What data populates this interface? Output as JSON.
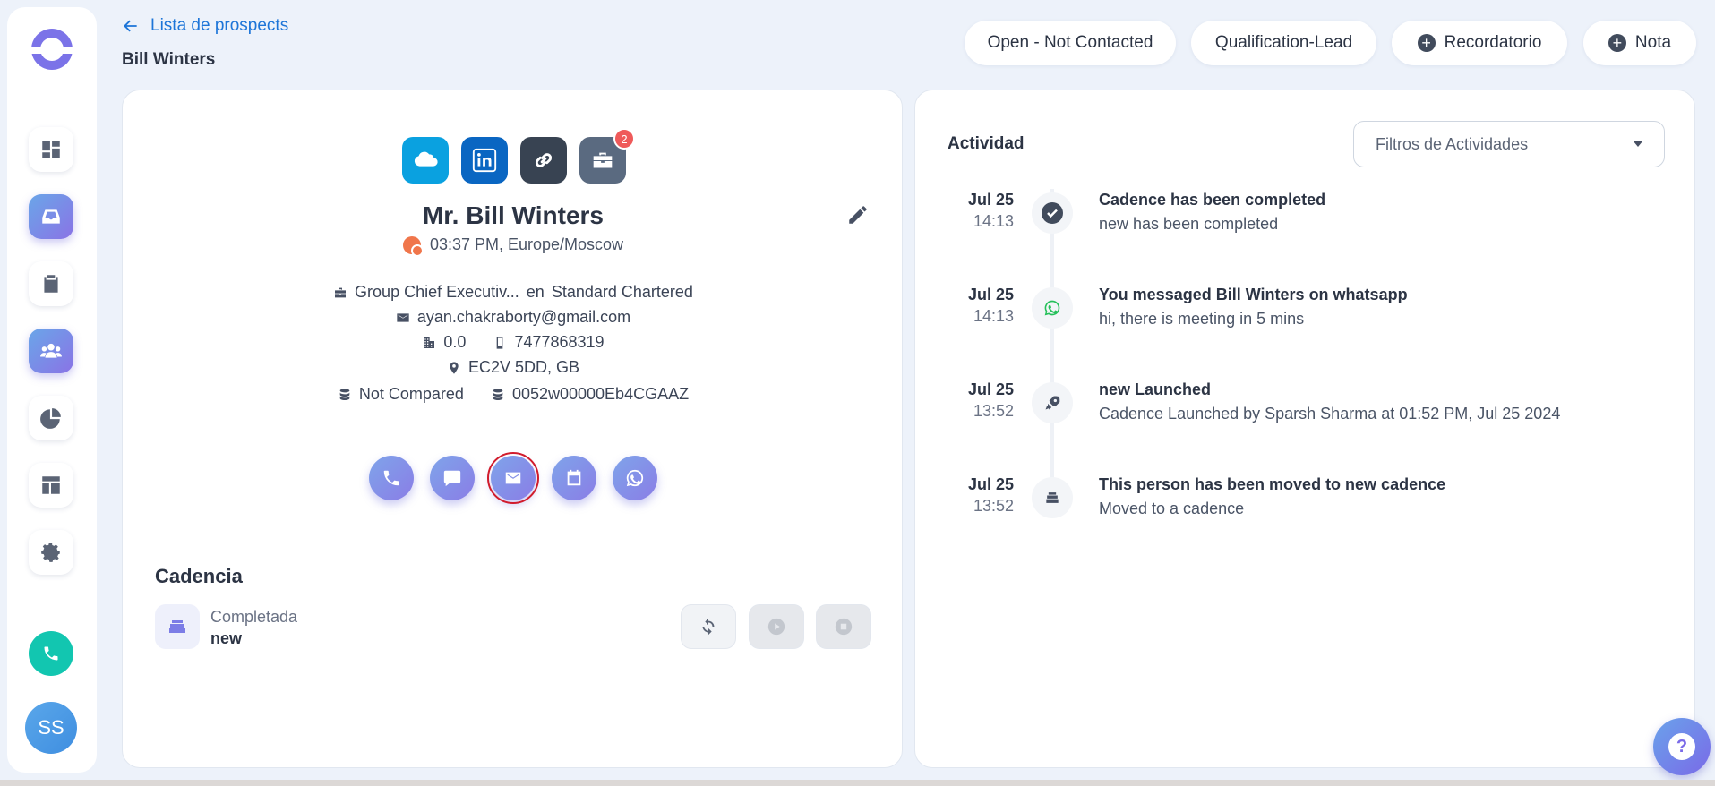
{
  "header": {
    "back_label": "Lista de prospects",
    "page_title": "Bill Winters",
    "status_pills": [
      "Open - Not Contacted",
      "Qualification-Lead"
    ],
    "reminder_label": "Recordatorio",
    "note_label": "Nota"
  },
  "sidebar": {
    "items": [
      "dashboard",
      "inbox",
      "tasks",
      "prospects",
      "reports",
      "templates",
      "settings"
    ],
    "active": "prospects",
    "avatar_initials": "SS"
  },
  "profile": {
    "social_badge": "2",
    "name": "Mr. Bill Winters",
    "timezone": "03:37 PM, Europe/Moscow",
    "title": "Group Chief Executiv...",
    "company_prefix": "en",
    "company": "Standard Chartered",
    "email": "ayan.chakraborty@gmail.com",
    "score": "0.0",
    "phone": "7477868319",
    "location": "EC2V 5DD, GB",
    "compare_status": "Not Compared",
    "record_id": "0052w00000Eb4CGAAZ"
  },
  "cadence": {
    "section_title": "Cadencia",
    "status": "Completada",
    "name": "new"
  },
  "activity": {
    "title": "Actividad",
    "filter_placeholder": "Filtros de Actividades",
    "items": [
      {
        "date": "Jul 25",
        "time": "14:13",
        "icon": "check-icon",
        "title": "Cadence has been completed",
        "body": "new has been completed"
      },
      {
        "date": "Jul 25",
        "time": "14:13",
        "icon": "whatsapp-icon",
        "title": "You messaged Bill Winters on whatsapp",
        "body": "hi, there is meeting in 5 mins"
      },
      {
        "date": "Jul 25",
        "time": "13:52",
        "icon": "rocket-icon",
        "title": "new Launched",
        "body": "Cadence Launched by Sparsh Sharma at 01:52 PM, Jul 25 2024"
      },
      {
        "date": "Jul 25",
        "time": "13:52",
        "icon": "stack-icon",
        "title": "This person has been moved to new cadence",
        "body": "Moved to a cadence"
      }
    ]
  },
  "colors": {
    "accent": "#1d75d8",
    "gradient_start": "#7fa4ea",
    "gradient_end": "#8a7de6",
    "badge": "#ef5a5a",
    "call_button": "#12c6b0"
  }
}
